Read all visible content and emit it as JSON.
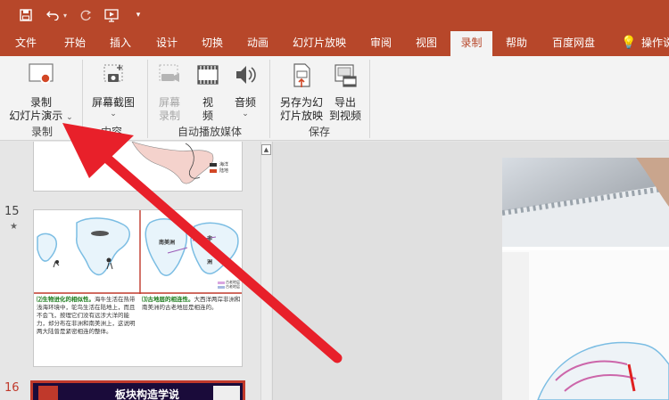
{
  "tabs": [
    "文件",
    "开始",
    "插入",
    "设计",
    "切换",
    "动画",
    "幻灯片放映",
    "审阅",
    "视图",
    "录制",
    "帮助",
    "百度网盘",
    "操作说"
  ],
  "ribbon": {
    "record_line1": "录制",
    "record_line2": "幻灯片演示",
    "screenshot": "屏幕截图",
    "screen_record": [
      "屏幕",
      "录制"
    ],
    "video": [
      "视",
      "频"
    ],
    "audio": "音频",
    "save_as_show": [
      "另存为幻",
      "灯片放映"
    ],
    "export_video": [
      "导出",
      "到视频"
    ],
    "groups": [
      "录制",
      "内容",
      "自动播放媒体",
      "保存"
    ]
  },
  "slides": [
    {
      "num": "15",
      "left_caption_title": "⑵生物进化的相似性。",
      "left_caption": "海牛生活在热带浅海环境中，鸵鸟生活在陆地上，而且不会飞，按理它们没有远涉大洋的能力，却分布在非洲和南美洲上，这说明两大陆曾是紧密相连的整体。",
      "right_caption_title": "⑶古地层的相连性。",
      "right_caption": "大西洋两岸非洲和南美洲的古老地层是相连的。",
      "map_labels": [
        "南美洲",
        "非",
        "洲"
      ],
      "legend": [
        "古老地层",
        "古老地层"
      ]
    },
    {
      "num": "16",
      "title": "板块构造学说"
    }
  ],
  "top_thumb_legend": [
    "海洋",
    "陆地"
  ]
}
